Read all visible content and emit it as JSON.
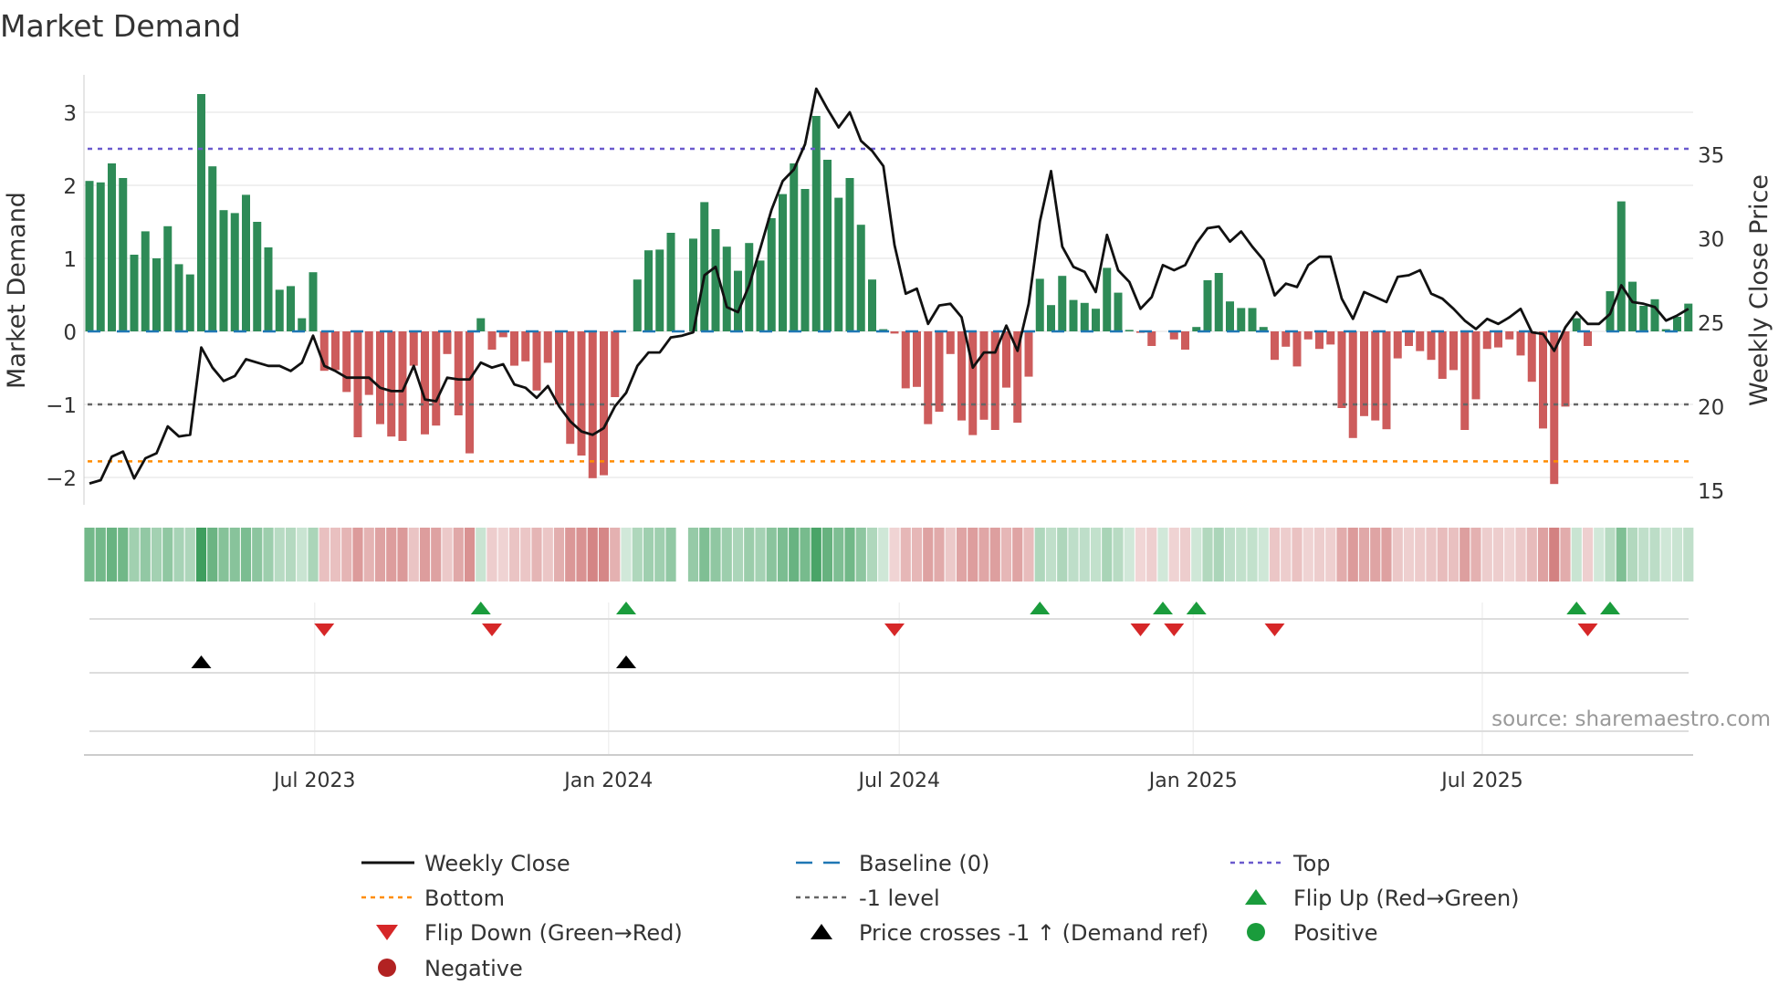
{
  "chart_data": {
    "type": "bar",
    "title": "Market Demand",
    "ylabel": "Market Demand",
    "y2label": "Weekly Close Price",
    "source": "source: sharemaestro.com",
    "x_start": "2023-02-10",
    "x_frequency": "weekly",
    "ylim": [
      -2.375,
      3.51
    ],
    "y2lim": [
      14.3,
      46.0
    ],
    "left_ticks": [
      {
        "v": -2,
        "label": "−2"
      },
      {
        "v": -1,
        "label": "−1"
      },
      {
        "v": 0,
        "label": "0"
      },
      {
        "v": 1,
        "label": "1"
      },
      {
        "v": 2,
        "label": "2"
      },
      {
        "v": 3,
        "label": "3"
      }
    ],
    "right_ticks": [
      {
        "v": 15,
        "label": "15"
      },
      {
        "v": 20,
        "label": "20"
      },
      {
        "v": 25,
        "label": "25"
      },
      {
        "v": 30,
        "label": "30"
      },
      {
        "v": 35,
        "label": "35"
      }
    ],
    "x_ticks": [
      {
        "date": "2023-07-01",
        "label": "Jul 2023"
      },
      {
        "date": "2024-01-01",
        "label": "Jan 2024"
      },
      {
        "date": "2024-07-01",
        "label": "Jul 2024"
      },
      {
        "date": "2025-01-01",
        "label": "Jan 2025"
      },
      {
        "date": "2025-07-01",
        "label": "Jul 2025"
      }
    ],
    "reference_lines": {
      "top": 2.5,
      "bottom": -1.78,
      "minus_one": -1,
      "baseline": 0
    },
    "demand": [
      2.06,
      2.04,
      2.3,
      2.1,
      1.05,
      1.37,
      1.0,
      1.44,
      0.92,
      0.78,
      3.25,
      2.26,
      1.66,
      1.62,
      1.87,
      1.5,
      1.15,
      0.57,
      0.62,
      0.18,
      0.81,
      -0.54,
      -0.53,
      -0.83,
      -1.45,
      -0.87,
      -1.27,
      -1.44,
      -1.5,
      -0.47,
      -1.41,
      -1.29,
      -0.31,
      -1.15,
      -1.67,
      0.18,
      -0.25,
      -0.08,
      -0.47,
      -0.41,
      -0.81,
      -0.43,
      -1.0,
      -1.54,
      -1.7,
      -2.01,
      -1.97,
      -0.9,
      0.0,
      0.71,
      1.11,
      1.12,
      1.35,
      null,
      1.27,
      1.77,
      1.4,
      1.16,
      0.83,
      1.21,
      0.97,
      1.55,
      1.88,
      2.3,
      1.95,
      2.95,
      2.35,
      1.83,
      2.1,
      1.46,
      0.71,
      0.03,
      -0.03,
      -0.78,
      -0.76,
      -1.27,
      -1.1,
      -0.31,
      -1.22,
      -1.42,
      -1.21,
      -1.35,
      -0.77,
      -1.25,
      -0.62,
      0.72,
      0.36,
      0.76,
      0.43,
      0.39,
      0.31,
      0.87,
      0.53,
      0.02,
      -0.02,
      -0.2,
      0.0,
      -0.11,
      -0.25,
      0.06,
      0.7,
      0.8,
      0.41,
      0.32,
      0.32,
      0.06,
      -0.39,
      -0.21,
      -0.48,
      -0.11,
      -0.24,
      -0.18,
      -1.05,
      -1.46,
      -1.16,
      -1.22,
      -1.34,
      -0.37,
      -0.2,
      -0.27,
      -0.39,
      -0.65,
      -0.53,
      -1.35,
      -0.93,
      -0.24,
      -0.22,
      -0.11,
      -0.33,
      -0.69,
      -1.33,
      -2.09,
      -1.03,
      0.18,
      -0.2,
      0.0,
      0.55,
      1.78,
      0.68,
      0.35,
      0.44,
      0.03,
      0.2,
      0.38
    ],
    "weekly_close": [
      15.4,
      15.6,
      17.0,
      17.3,
      15.7,
      16.9,
      17.2,
      18.8,
      18.2,
      18.3,
      23.5,
      22.3,
      21.5,
      21.8,
      22.8,
      22.6,
      22.4,
      22.4,
      22.1,
      22.6,
      24.2,
      22.4,
      22.1,
      21.7,
      21.7,
      21.7,
      21.1,
      20.9,
      20.9,
      22.4,
      20.4,
      20.3,
      21.7,
      21.6,
      21.6,
      22.6,
      22.3,
      22.5,
      21.3,
      21.1,
      20.5,
      21.2,
      20.0,
      19.1,
      18.5,
      18.3,
      18.7,
      20.0,
      20.8,
      22.4,
      23.2,
      23.2,
      24.1,
      24.2,
      24.4,
      27.8,
      28.3,
      25.9,
      25.6,
      27.2,
      29.4,
      31.7,
      33.4,
      34.1,
      35.6,
      38.9,
      37.7,
      36.6,
      37.5,
      35.8,
      35.2,
      34.3,
      29.6,
      26.7,
      27.0,
      24.9,
      26.0,
      26.1,
      25.3,
      22.3,
      23.2,
      23.2,
      24.8,
      23.3,
      26.1,
      31.0,
      34.0,
      29.5,
      28.3,
      28.0,
      26.8,
      30.2,
      28.1,
      27.4,
      25.8,
      26.5,
      28.4,
      28.1,
      28.4,
      29.7,
      30.6,
      30.7,
      29.8,
      30.4,
      29.5,
      28.7,
      26.6,
      27.3,
      27.1,
      28.4,
      28.9,
      28.9,
      26.4,
      25.2,
      26.8,
      26.5,
      26.2,
      27.7,
      27.8,
      28.1,
      26.7,
      26.4,
      25.8,
      25.1,
      24.6,
      25.2,
      24.9,
      25.3,
      25.8,
      24.4,
      24.3,
      23.3,
      24.7,
      25.6,
      24.9,
      24.9,
      25.5,
      27.2,
      26.2,
      26.1,
      25.9,
      25.1,
      25.4,
      25.8
    ],
    "events": {
      "flip_up": [
        "2023-10-13",
        "2024-01-12",
        "2024-09-27",
        "2024-12-13",
        "2025-01-03",
        "2025-08-29",
        "2025-09-19"
      ],
      "flip_down": [
        "2023-07-07",
        "2023-10-20",
        "2024-06-28",
        "2024-11-29",
        "2024-12-20",
        "2025-02-21",
        "2025-09-05"
      ],
      "price_cross_up": [
        "2023-04-21",
        "2024-01-12"
      ]
    },
    "legend": [
      {
        "label": "Weekly Close",
        "kind": "line",
        "color": "#111111"
      },
      {
        "label": "Baseline (0)",
        "kind": "dash",
        "color": "#1f77b4"
      },
      {
        "label": "Top",
        "kind": "dot",
        "color": "#6a5acd"
      },
      {
        "label": "Bottom",
        "kind": "dot",
        "color": "#ff8c00"
      },
      {
        "label": "-1 level",
        "kind": "dot",
        "color": "#666666"
      },
      {
        "label": "Flip Up (Red→Green)",
        "kind": "tri-up",
        "color": "#1a9c3c"
      },
      {
        "label": "Flip Down (Green→Red)",
        "kind": "tri-down",
        "color": "#d62728"
      },
      {
        "label": "Price crosses -1 ↑ (Demand ref)",
        "kind": "tri-up",
        "color": "#000000"
      },
      {
        "label": "Positive",
        "kind": "circle",
        "color": "#1a9c3c"
      },
      {
        "label": "Negative",
        "kind": "circle",
        "color": "#b22222"
      }
    ],
    "colors": {
      "positive": "#2e8b57",
      "negative": "#cd5c5c",
      "top": "#6a5acd",
      "bottom": "#ff8c00",
      "minus_one": "#666666",
      "baseline": "#1f77b4"
    }
  }
}
